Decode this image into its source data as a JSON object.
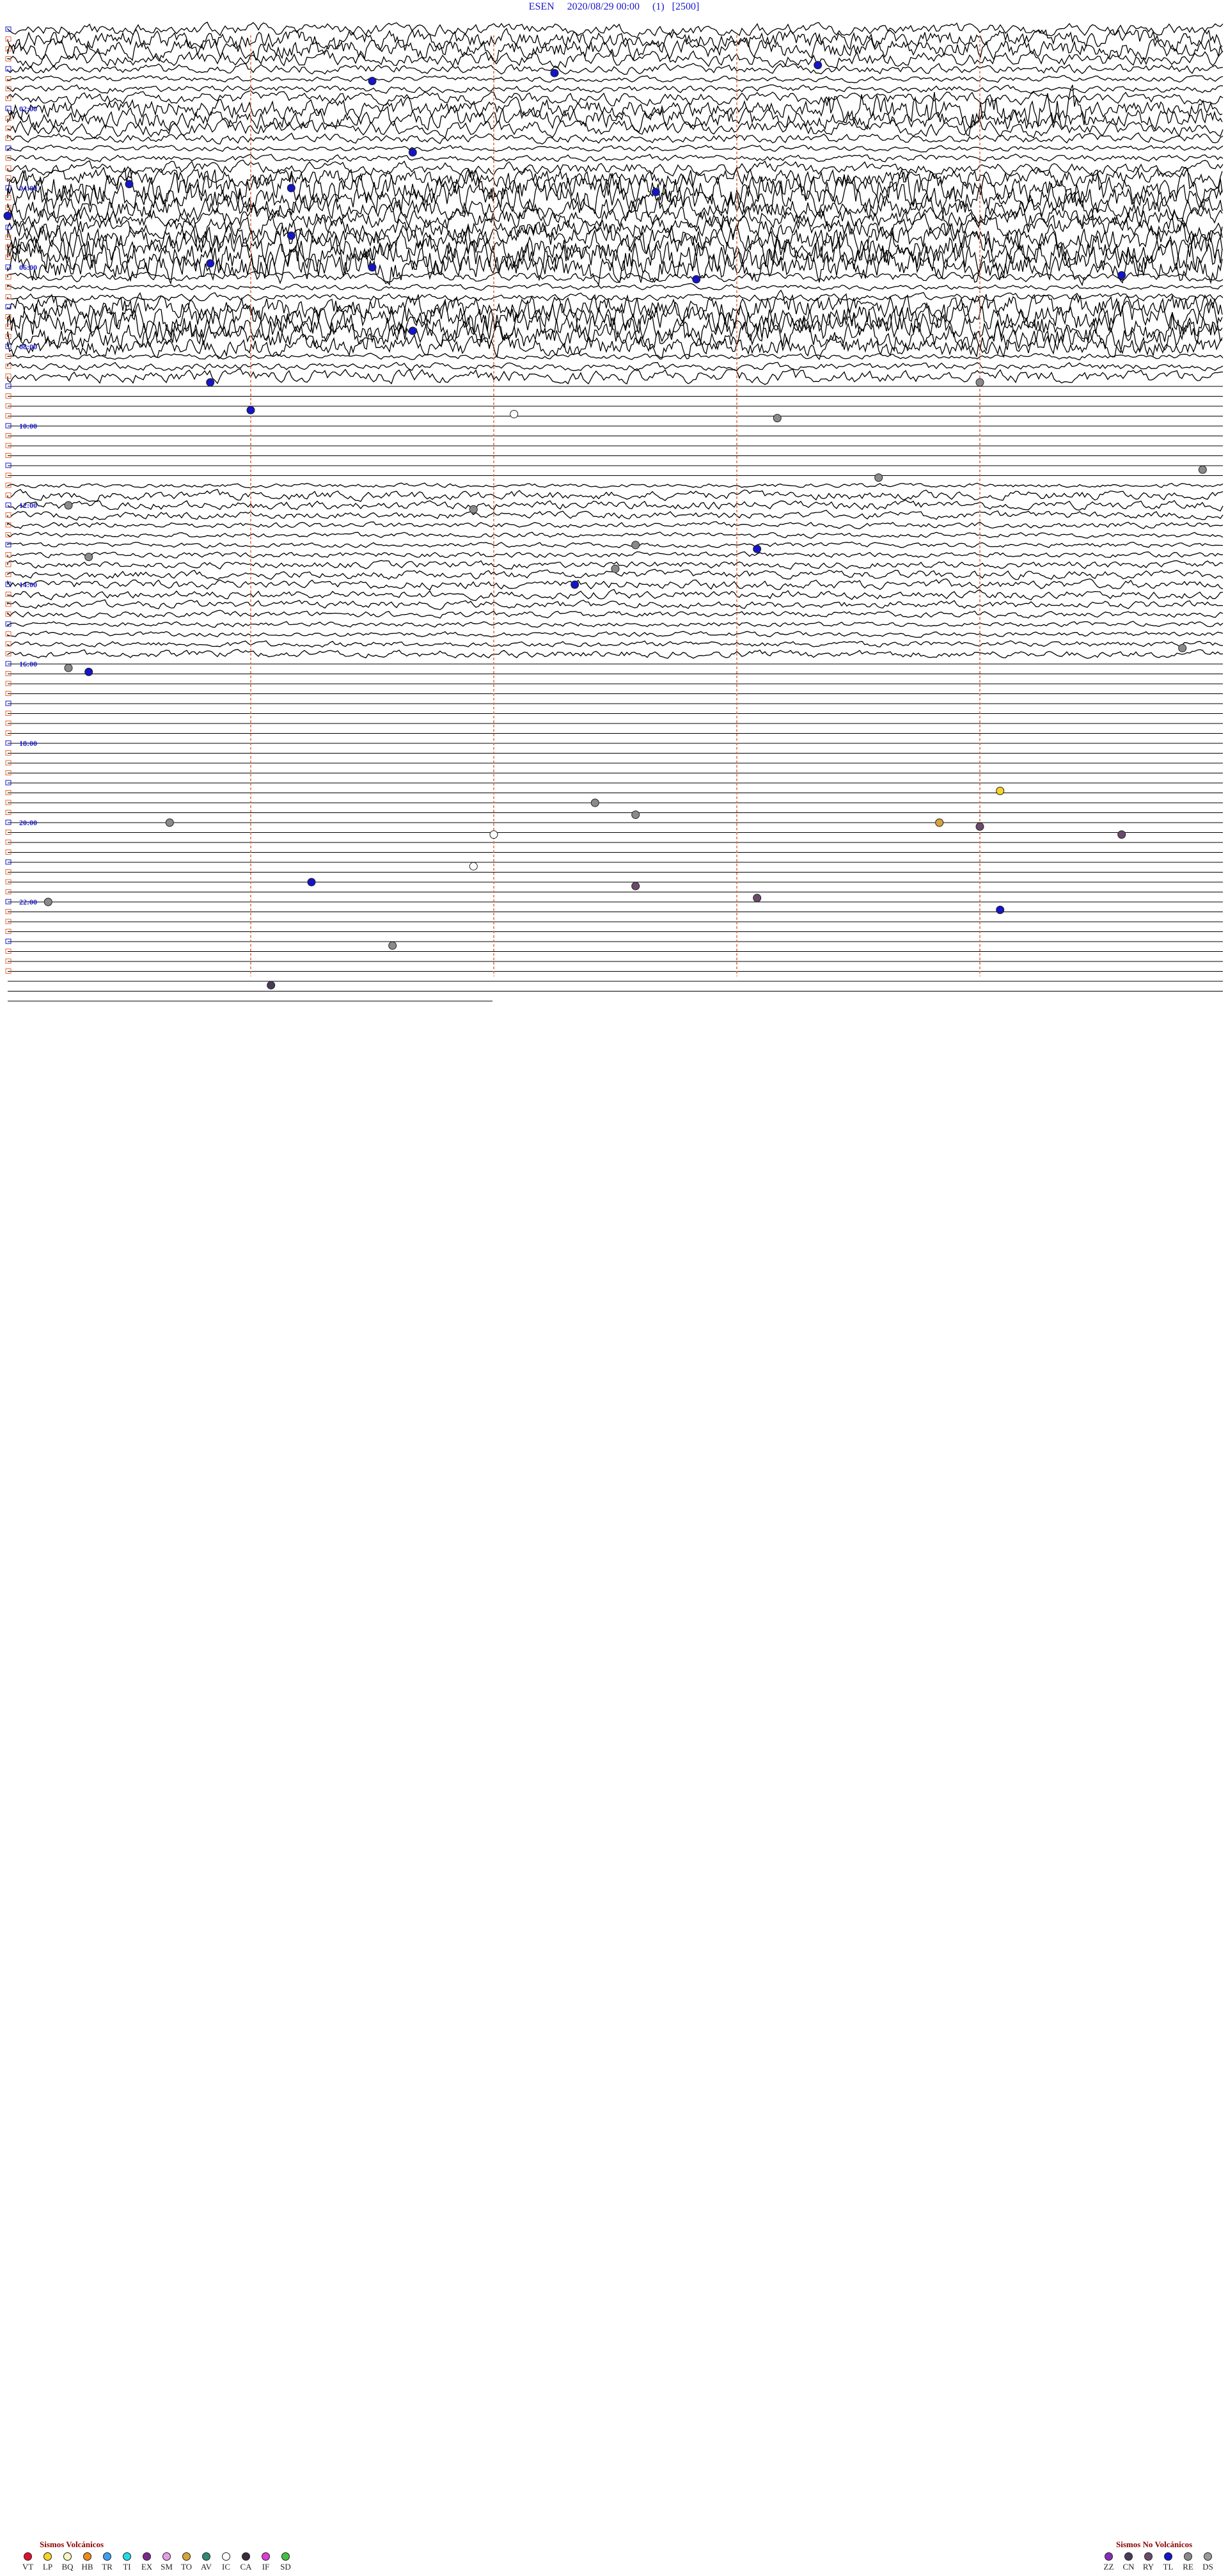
{
  "header": {
    "station": "ESEN",
    "datetime": "2020/08/29 00:00",
    "channel": "(1)",
    "scale": "[2500]"
  },
  "time_labels": [
    "02:00",
    "04:00",
    "06:00",
    "08:00",
    "10:00",
    "12:00",
    "14:00",
    "16:00",
    "18:00",
    "20:00",
    "22:00"
  ],
  "legend": {
    "volcanic_title": "Sismos Volcánicos",
    "volcanic": [
      {
        "code": "VT",
        "color": "#e0102a"
      },
      {
        "code": "LP",
        "color": "#f5d327"
      },
      {
        "code": "BQ",
        "color": "#f5f5c0"
      },
      {
        "code": "HB",
        "color": "#f08a1a"
      },
      {
        "code": "TR",
        "color": "#3e9ef5"
      },
      {
        "code": "TI",
        "color": "#23dbe6"
      },
      {
        "code": "EX",
        "color": "#7a2a8c"
      },
      {
        "code": "SM",
        "color": "#e59ee6"
      },
      {
        "code": "TO",
        "color": "#d7a43a"
      },
      {
        "code": "AV",
        "color": "#2f8a76"
      },
      {
        "code": "IC",
        "color": "#ffffff"
      },
      {
        "code": "CA",
        "color": "#3a2a3a"
      },
      {
        "code": "IF",
        "color": "#e03ad8"
      },
      {
        "code": "SD",
        "color": "#43c043"
      }
    ],
    "non_volcanic_title": "Sismos No Volcánicos",
    "non_volcanic": [
      {
        "code": "ZZ",
        "color": "#8a2ab8"
      },
      {
        "code": "CN",
        "color": "#4a3a5a"
      },
      {
        "code": "RY",
        "color": "#6a4a6a"
      },
      {
        "code": "TL",
        "color": "#1414c8"
      },
      {
        "code": "RE",
        "color": "#8a8a8a"
      },
      {
        "code": "DS",
        "color": "#9a9a9a"
      }
    ]
  },
  "trace_colors": {
    "trace": "#000000",
    "marker": "#e06a3a",
    "label": "#1a1ac8"
  },
  "events": [
    {
      "minute": 40,
      "hour": 0.9,
      "color": "#1414c8"
    },
    {
      "minute": 27,
      "hour": 1.1,
      "color": "#1414c8"
    },
    {
      "minute": 18,
      "hour": 1.3,
      "color": "#1414c8"
    },
    {
      "minute": 6,
      "hour": 3.9,
      "color": "#1414c8"
    },
    {
      "minute": 14,
      "hour": 4.0,
      "color": "#1414c8"
    },
    {
      "minute": 32,
      "hour": 4.1,
      "color": "#1414c8"
    },
    {
      "minute": 20,
      "hour": 3.1,
      "color": "#1414c8"
    },
    {
      "minute": 0,
      "hour": 4.7,
      "color": "#1414c8"
    },
    {
      "minute": 14,
      "hour": 5.2,
      "color": "#1414c8"
    },
    {
      "minute": 10,
      "hour": 5.9,
      "color": "#1414c8"
    },
    {
      "minute": 18,
      "hour": 6.0,
      "color": "#1414c8"
    },
    {
      "minute": 34,
      "hour": 6.3,
      "color": "#1414c8"
    },
    {
      "minute": 55,
      "hour": 6.2,
      "color": "#1414c8"
    },
    {
      "minute": 20,
      "hour": 7.6,
      "color": "#1414c8"
    },
    {
      "minute": 10,
      "hour": 8.9,
      "color": "#1414c8"
    },
    {
      "minute": 48,
      "hour": 8.9,
      "color": "#8a8a8a"
    },
    {
      "minute": 12,
      "hour": 9.6,
      "color": "#1414c8"
    },
    {
      "minute": 25,
      "hour": 9.7,
      "color": "#ffffff"
    },
    {
      "minute": 38,
      "hour": 9.8,
      "color": "#8a8a8a"
    },
    {
      "minute": 43,
      "hour": 11.3,
      "color": "#8a8a8a"
    },
    {
      "minute": 59,
      "hour": 11.1,
      "color": "#8a8a8a"
    },
    {
      "minute": 3,
      "hour": 12.0,
      "color": "#8a8a8a"
    },
    {
      "minute": 23,
      "hour": 12.1,
      "color": "#8a8a8a"
    },
    {
      "minute": 37,
      "hour": 13.1,
      "color": "#1414c8"
    },
    {
      "minute": 31,
      "hour": 13.0,
      "color": "#8a8a8a"
    },
    {
      "minute": 4,
      "hour": 13.3,
      "color": "#8a8a8a"
    },
    {
      "minute": 30,
      "hour": 13.6,
      "color": "#8a8a8a"
    },
    {
      "minute": 28,
      "hour": 14.0,
      "color": "#1414c8"
    },
    {
      "minute": 58,
      "hour": 15.6,
      "color": "#8a8a8a"
    },
    {
      "minute": 3,
      "hour": 16.1,
      "color": "#8a8a8a"
    },
    {
      "minute": 4,
      "hour": 16.2,
      "color": "#1414c8"
    },
    {
      "minute": 49,
      "hour": 19.2,
      "color": "#f5d327"
    },
    {
      "minute": 29,
      "hour": 19.5,
      "color": "#8a8a8a"
    },
    {
      "minute": 31,
      "hour": 19.8,
      "color": "#8a8a8a"
    },
    {
      "minute": 8,
      "hour": 20.0,
      "color": "#8a8a8a"
    },
    {
      "minute": 46,
      "hour": 20.0,
      "color": "#d7a43a"
    },
    {
      "minute": 48,
      "hour": 20.1,
      "color": "#6a4a6a"
    },
    {
      "minute": 55,
      "hour": 20.3,
      "color": "#6a4a6a"
    },
    {
      "minute": 24,
      "hour": 20.3,
      "color": "#ffffff"
    },
    {
      "minute": 23,
      "hour": 21.1,
      "color": "#ffffff"
    },
    {
      "minute": 15,
      "hour": 21.5,
      "color": "#1414c8"
    },
    {
      "minute": 31,
      "hour": 21.6,
      "color": "#6a4a6a"
    },
    {
      "minute": 37,
      "hour": 21.9,
      "color": "#6a4a6a"
    },
    {
      "minute": 2,
      "hour": 22.0,
      "color": "#8a8a8a"
    },
    {
      "minute": 49,
      "hour": 22.2,
      "color": "#1414c8"
    },
    {
      "minute": 19,
      "hour": 23.1,
      "color": "#8a8a8a"
    },
    {
      "minute": 13,
      "hour": 24.1,
      "color": "#4a3a5a"
    }
  ]
}
